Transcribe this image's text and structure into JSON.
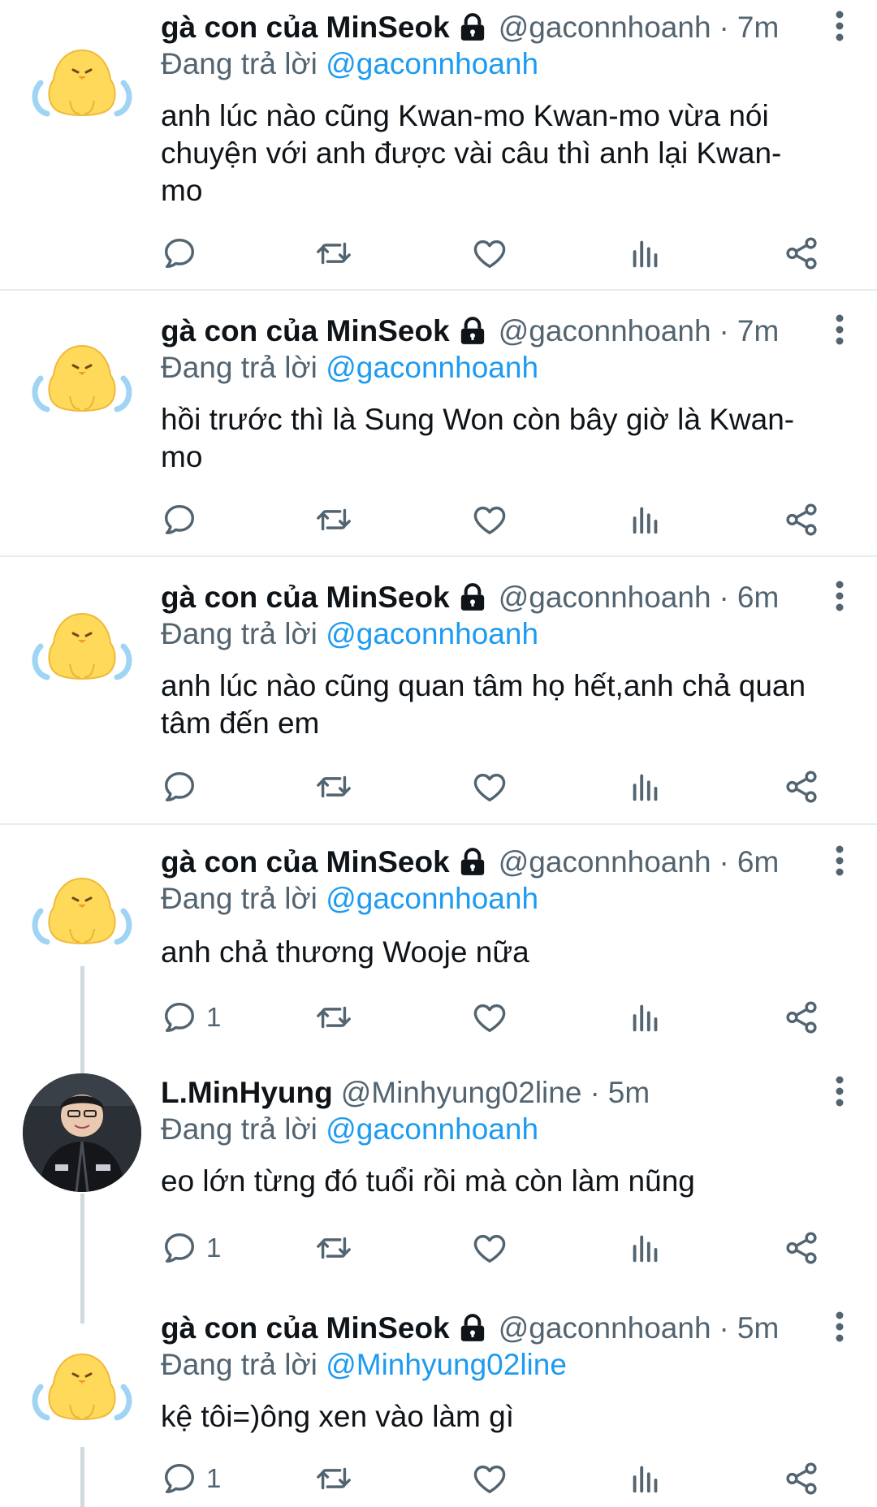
{
  "tweets": [
    {
      "author_name": "gà con của MinSeok",
      "author_handle": "@gaconnhoanh",
      "time": "7m",
      "reply_label": "Đang trả lời",
      "reply_mention": "@gaconnhoanh",
      "text_lines": [
        "anh lúc nào cũng Kwan-mo Kwan-mo vừa nói",
        "chuyện với anh được vài câu thì anh lại Kwan-",
        "mo"
      ],
      "reply_count": ""
    },
    {
      "author_name": "gà con của MinSeok",
      "author_handle": "@gaconnhoanh",
      "time": "7m",
      "reply_label": "Đang trả lời",
      "reply_mention": "@gaconnhoanh",
      "text_lines": [
        "hồi trước thì là Sung Won còn bây giờ là Kwan-",
        "mo"
      ],
      "reply_count": ""
    },
    {
      "author_name": "gà con của MinSeok",
      "author_handle": "@gaconnhoanh",
      "time": "6m",
      "reply_label": "Đang trả lời",
      "reply_mention": "@gaconnhoanh",
      "text_lines": [
        "anh lúc nào cũng quan tâm họ hết,anh chả quan",
        "tâm đến em"
      ],
      "reply_count": ""
    },
    {
      "author_name": "gà con của MinSeok",
      "author_handle": "@gaconnhoanh",
      "time": "6m",
      "reply_label": "Đang trả lời",
      "reply_mention": "@gaconnhoanh",
      "text_lines": [
        "anh chả thương Wooje nữa"
      ],
      "reply_count": "1"
    },
    {
      "author_name": "L.MinHyung",
      "author_handle": "@Minhyung02line",
      "time": "5m",
      "reply_label": "Đang trả lời",
      "reply_mention": "@gaconnhoanh",
      "text_lines": [
        "eo lớn từng đó tuổi rồi mà còn làm nũng"
      ],
      "reply_count": "1"
    },
    {
      "author_name": "gà con của MinSeok",
      "author_handle": "@gaconnhoanh",
      "time": "5m",
      "reply_label": "Đang trả lời",
      "reply_mention": "@Minhyung02line",
      "text_lines": [
        "kệ tôi=)ông xen vào làm gì"
      ],
      "reply_count": "1"
    }
  ],
  "colors": {
    "accent": "#1d9bf0",
    "secondary_text": "#536471",
    "divider": "#e6ecf0",
    "thread_line": "#cfd9de"
  },
  "icons": {
    "reply": "speech-bubble-icon",
    "retweet": "retweet-icon",
    "like": "heart-icon",
    "views": "bar-chart-icon",
    "share": "share-icon",
    "more": "vertical-dots-icon",
    "protected": "lock-icon"
  }
}
